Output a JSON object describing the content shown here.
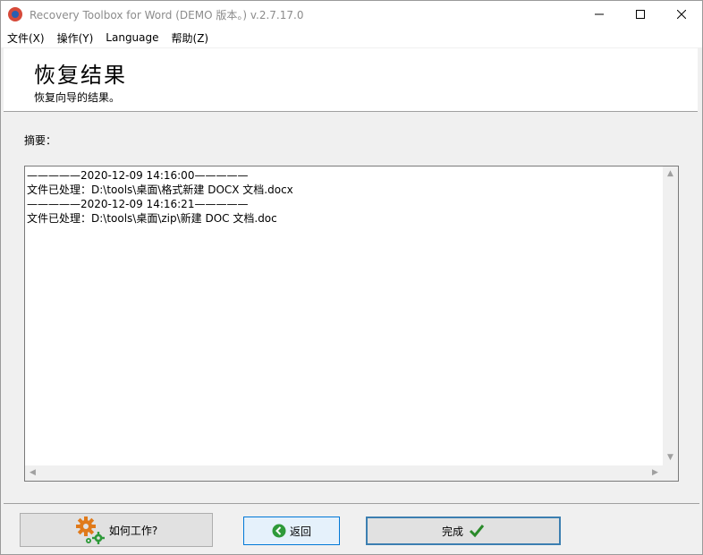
{
  "window": {
    "title": "Recovery Toolbox for Word (DEMO 版本。) v.2.7.17.0"
  },
  "menu": {
    "items": [
      "文件(X)",
      "操作(Y)",
      "Language",
      "帮助(Z)"
    ]
  },
  "header": {
    "title": "恢复结果",
    "subtitle": "恢复向导的结果。"
  },
  "summary": {
    "label": "摘要：",
    "lines": [
      "—————2020-12-09 14:16:00—————",
      "文件已处理：D:\\tools\\桌面\\格式新建 DOCX 文档.docx",
      "—————2020-12-09 14:16:21—————",
      "文件已处理：D:\\tools\\桌面\\zip\\新建 DOC 文档.doc"
    ]
  },
  "buttons": {
    "help": "如何工作?",
    "back": "返回",
    "finish": "完成"
  },
  "colors": {
    "accent": "#0078d7",
    "finish_check": "#2a8a2a",
    "gear_orange": "#e07a1a",
    "gear_green": "#2e9a3a"
  }
}
